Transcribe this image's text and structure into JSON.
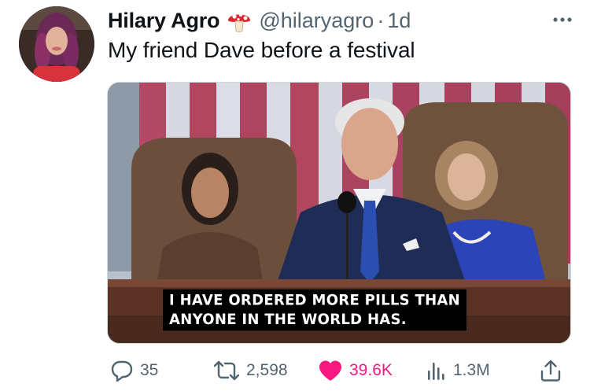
{
  "author": {
    "display_name": "Hilary Agro",
    "badge_icon": "mushroom-icon",
    "handle": "@hilaryagro",
    "separator": "·",
    "time": "1d"
  },
  "tweet": {
    "text": "My friend Dave before a festival"
  },
  "media": {
    "caption_line1": "I HAVE ORDERED MORE PILLS THAN",
    "caption_line2": "ANYONE IN THE WORLD HAS."
  },
  "actions": {
    "replies": "35",
    "reposts": "2,598",
    "likes": "39.6K",
    "views": "1.3M"
  },
  "colors": {
    "text": "#0f1419",
    "secondary": "#536471",
    "like": "#f91880"
  }
}
